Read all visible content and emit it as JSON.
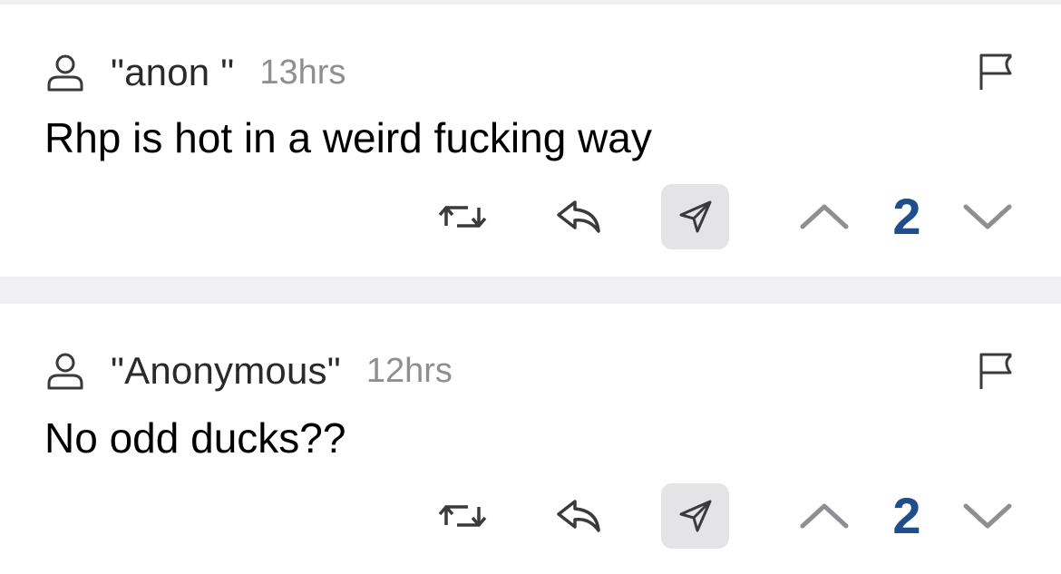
{
  "posts": [
    {
      "author": "\"anon \"",
      "time": "13hrs",
      "text": "Rhp is hot in a weird fucking way",
      "score": "2"
    },
    {
      "author": "\"Anonymous\"",
      "time": "12hrs",
      "text": "No odd ducks??",
      "score": "2"
    }
  ],
  "icons": {
    "user": "user-icon",
    "flag": "flag-icon",
    "repost": "repost-icon",
    "reply": "reply-icon",
    "share": "send-icon",
    "upvote": "chevron-up-icon",
    "downvote": "chevron-down-icon"
  },
  "colors": {
    "score": "#1f4e8c",
    "muted": "#8e8e93",
    "divider": "#efeff4",
    "share_bg": "#e4e4e7"
  }
}
